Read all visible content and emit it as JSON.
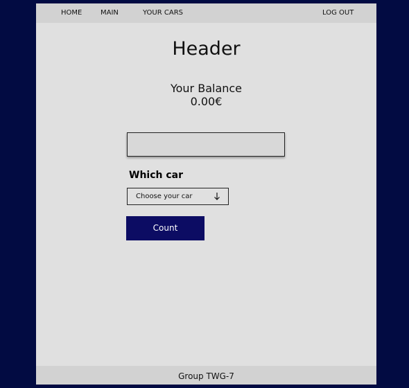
{
  "nav": {
    "home": "HOME",
    "main": "MAIN",
    "your_cars": "YOUR CARS",
    "log_out": "LOG OUT"
  },
  "header": {
    "title": "Header"
  },
  "balance": {
    "label": "Your Balance",
    "value": "0.00€"
  },
  "form": {
    "text_field_value": "",
    "which_car_label": "Which car",
    "car_select": {
      "selected": "Choose your car",
      "icon": "arrow-down-icon"
    },
    "count_button": "Count"
  },
  "footer": {
    "text": "Group TWG-7"
  },
  "colors": {
    "background": "#020b42",
    "page": "#e0e0e0",
    "bars": "#d2d2d2",
    "button": "#0c0c63",
    "button_text": "#ffffff"
  }
}
